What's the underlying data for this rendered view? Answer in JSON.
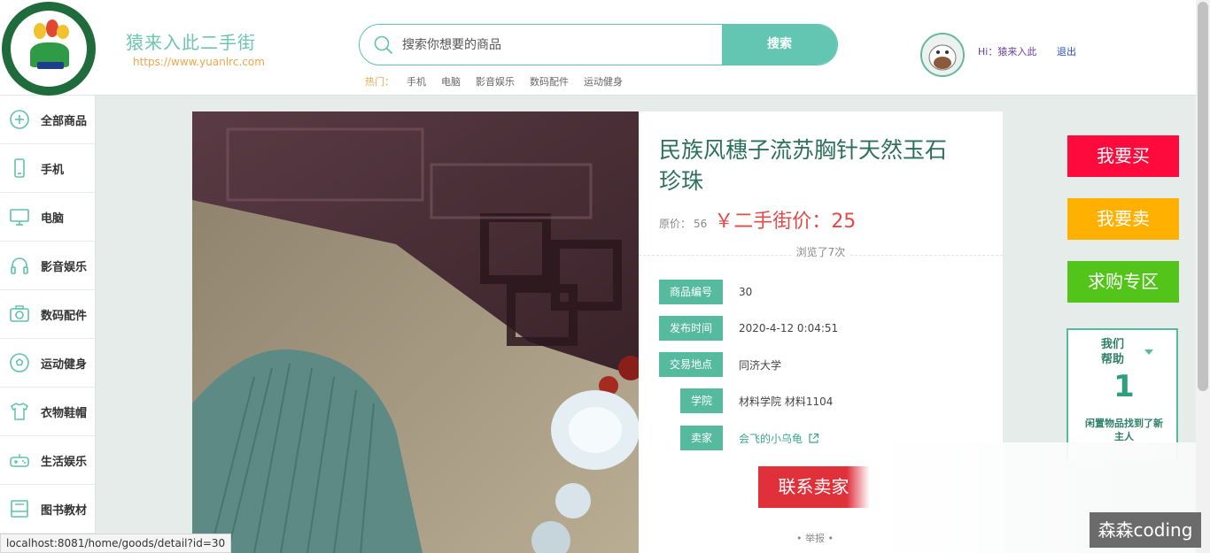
{
  "header": {
    "site_name": "猿来入此二手街",
    "site_url": "https://www.yuanlrc.com",
    "search": {
      "placeholder": "搜索你想要的商品",
      "button": "搜索"
    },
    "hot": {
      "label": "热门：",
      "items": [
        "手机",
        "电脑",
        "影音娱乐",
        "数码配件",
        "运动健身"
      ]
    },
    "user": {
      "greeting": "Hi：猿来入此",
      "logout": "退出"
    }
  },
  "sidebar": {
    "items": [
      {
        "label": "全部商品",
        "icon": "plus-circle-icon"
      },
      {
        "label": "手机",
        "icon": "phone-icon"
      },
      {
        "label": "电脑",
        "icon": "monitor-icon"
      },
      {
        "label": "影音娱乐",
        "icon": "headphones-icon"
      },
      {
        "label": "数码配件",
        "icon": "camera-icon"
      },
      {
        "label": "运动健身",
        "icon": "ball-icon"
      },
      {
        "label": "衣物鞋帽",
        "icon": "shirt-icon"
      },
      {
        "label": "生活娱乐",
        "icon": "gamepad-icon"
      },
      {
        "label": "图书教材",
        "icon": "book-icon"
      }
    ]
  },
  "product": {
    "title": "民族风穗子流苏胸针天然玉石珍珠",
    "orig_price_label": "原价：",
    "orig_price": "56",
    "price_label": "￥二手街价：",
    "price": "25",
    "views": "浏览了7次",
    "fields": [
      {
        "label": "商品编号",
        "value": "30"
      },
      {
        "label": "发布时间",
        "value": "2020-4-12 0:04:51"
      },
      {
        "label": "交易地点",
        "value": "同济大学"
      },
      {
        "label": "学院",
        "value": "材料学院 材料1104"
      },
      {
        "label": "卖家",
        "value": "会飞的小乌龟"
      }
    ],
    "contact_button": "联系卖家",
    "report": "举报"
  },
  "actions": {
    "buy": "我要买",
    "sell": "我要卖",
    "wanted": "求购专区",
    "help_title": "我们帮助",
    "help_count": "1",
    "help_sub": "闲置物品找到了新主人"
  },
  "status_url": "localhost:8081/home/goods/detail?id=30",
  "watermark": "森森coding",
  "colors": {
    "accent": "#63c6b2",
    "price": "#e24a4a",
    "buy": "#ff0a3c",
    "sell": "#ffb000",
    "wanted": "#52c41a"
  }
}
